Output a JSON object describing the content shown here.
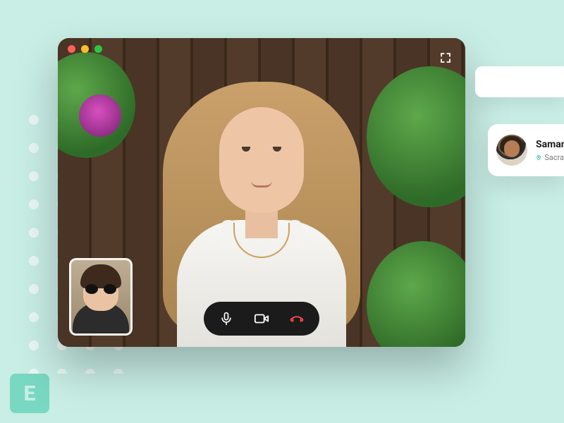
{
  "window": {
    "traffic_light_colors": {
      "close": "#ff5f57",
      "minimize": "#febc2e",
      "zoom": "#28c840"
    }
  },
  "controls": {
    "mic_label": "Mute microphone",
    "camera_label": "Toggle camera",
    "end_label": "End call",
    "expand_label": "Enter fullscreen"
  },
  "contact": {
    "name": "Saman",
    "location": "Sacra"
  },
  "logo": {
    "letter": "E"
  }
}
